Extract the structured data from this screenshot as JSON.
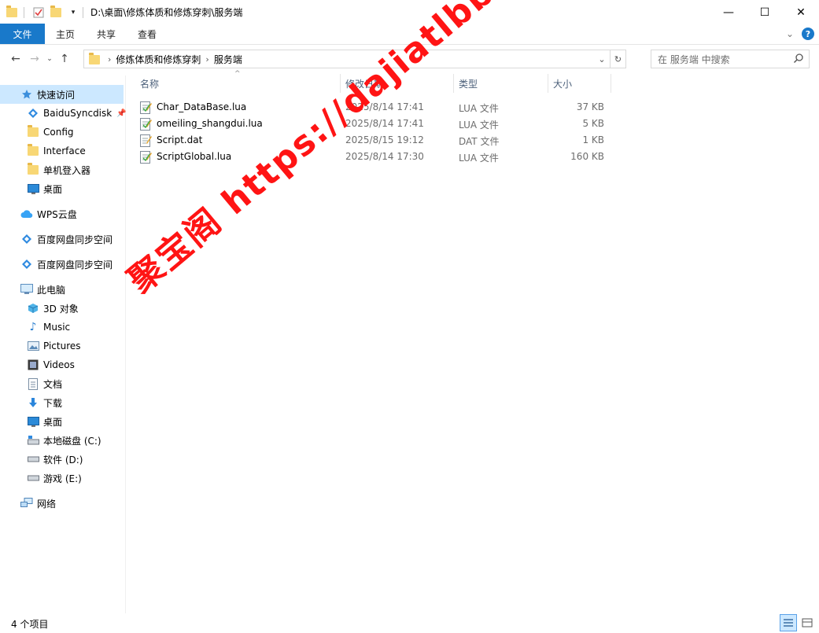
{
  "window": {
    "title": "D:\\桌面\\修炼体质和修炼穿刺\\服务端",
    "controls": {
      "minimize": "—",
      "maximize": "☐",
      "close": "✕"
    }
  },
  "ribbon": {
    "tabs": [
      "文件",
      "主页",
      "共享",
      "查看"
    ],
    "expand_icon": "chevron-down-icon",
    "help": "?"
  },
  "address": {
    "crumbs": [
      "修炼体质和修炼穿刺",
      "服务端"
    ],
    "search_placeholder": "在 服务端 中搜索"
  },
  "sidebar": {
    "items": [
      {
        "label": "快速访问",
        "icon": "star-icon"
      },
      {
        "label": "BaiduSyncdisk",
        "icon": "baidu-sync-icon",
        "pinned": true
      },
      {
        "label": "Config",
        "icon": "folder-icon"
      },
      {
        "label": "Interface",
        "icon": "folder-icon"
      },
      {
        "label": "单机登入器",
        "icon": "folder-icon"
      },
      {
        "label": "桌面",
        "icon": "desktop-icon"
      },
      {
        "label": "WPS云盘",
        "icon": "cloud-icon"
      },
      {
        "label": "百度网盘同步空间",
        "icon": "baidu-sync-icon"
      },
      {
        "label": "百度网盘同步空间",
        "icon": "baidu-sync-icon"
      },
      {
        "label": "此电脑",
        "icon": "computer-icon"
      },
      {
        "label": "3D 对象",
        "icon": "cube-icon"
      },
      {
        "label": "Music",
        "icon": "music-icon"
      },
      {
        "label": "Pictures",
        "icon": "pictures-icon"
      },
      {
        "label": "Videos",
        "icon": "videos-icon"
      },
      {
        "label": "文档",
        "icon": "documents-icon"
      },
      {
        "label": "下载",
        "icon": "download-icon"
      },
      {
        "label": "桌面",
        "icon": "desktop-icon"
      },
      {
        "label": "本地磁盘 (C:)",
        "icon": "drive-icon"
      },
      {
        "label": "软件 (D:)",
        "icon": "drive-icon"
      },
      {
        "label": "游戏 (E:)",
        "icon": "drive-icon"
      },
      {
        "label": "网络",
        "icon": "network-icon"
      }
    ]
  },
  "columns": {
    "name": "名称",
    "date": "修改日期",
    "type": "类型",
    "size": "大小"
  },
  "files": [
    {
      "name": "Char_DataBase.lua",
      "date": "2025/8/14 17:41",
      "type": "LUA 文件",
      "size": "37 KB"
    },
    {
      "name": "omeiling_shangdui.lua",
      "date": "2025/8/14 17:41",
      "type": "LUA 文件",
      "size": "5 KB"
    },
    {
      "name": "Script.dat",
      "date": "2025/8/15 19:12",
      "type": "DAT 文件",
      "size": "1 KB"
    },
    {
      "name": "ScriptGlobal.lua",
      "date": "2025/8/14 17:30",
      "type": "LUA 文件",
      "size": "160 KB"
    }
  ],
  "status": {
    "count": "4 个项目"
  },
  "watermark": "聚宝阁 https://dajiatlbb.com/",
  "colors": {
    "accent": "#1979ca",
    "selected": "#cce8ff",
    "watermark": "#ff1414"
  }
}
